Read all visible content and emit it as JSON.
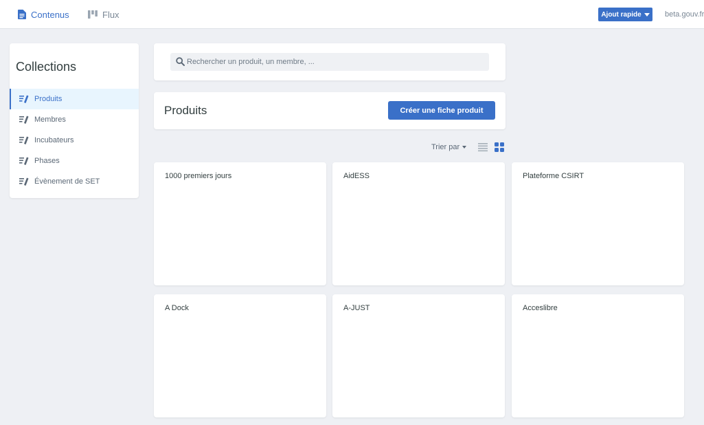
{
  "topbar": {
    "nav": [
      {
        "label": "Contenus",
        "icon": "file-text-icon",
        "active": true
      },
      {
        "label": "Flux",
        "icon": "kanban-icon",
        "active": false
      }
    ],
    "quick_add_label": "Ajout rapide",
    "site_label": "beta.gouv.fr"
  },
  "sidebar": {
    "title": "Collections",
    "items": [
      {
        "label": "Produits",
        "icon": "collection-icon",
        "active": true
      },
      {
        "label": "Membres",
        "icon": "collection-icon",
        "active": false
      },
      {
        "label": "Incubateurs",
        "icon": "collection-icon",
        "active": false
      },
      {
        "label": "Phases",
        "icon": "collection-icon",
        "active": false
      },
      {
        "label": "Évènement de SET",
        "icon": "collection-icon",
        "active": false
      }
    ]
  },
  "search": {
    "placeholder": "Rechercher un produit, un membre, ...",
    "value": ""
  },
  "main": {
    "title": "Produits",
    "create_label": "Créer une fiche produit",
    "sort_label": "Trier par",
    "view_mode": "grid"
  },
  "entries": [
    {
      "title": "1000 premiers jours"
    },
    {
      "title": "AidESS"
    },
    {
      "title": "Plateforme CSIRT"
    },
    {
      "title": "A Dock"
    },
    {
      "title": "A-JUST"
    },
    {
      "title": "Acceslibre"
    }
  ],
  "colors": {
    "accent": "#3a70c8",
    "background": "#eef0f4",
    "active_item_bg": "#e8f5fe",
    "text": "#313d3e",
    "muted": "#7a8795"
  }
}
